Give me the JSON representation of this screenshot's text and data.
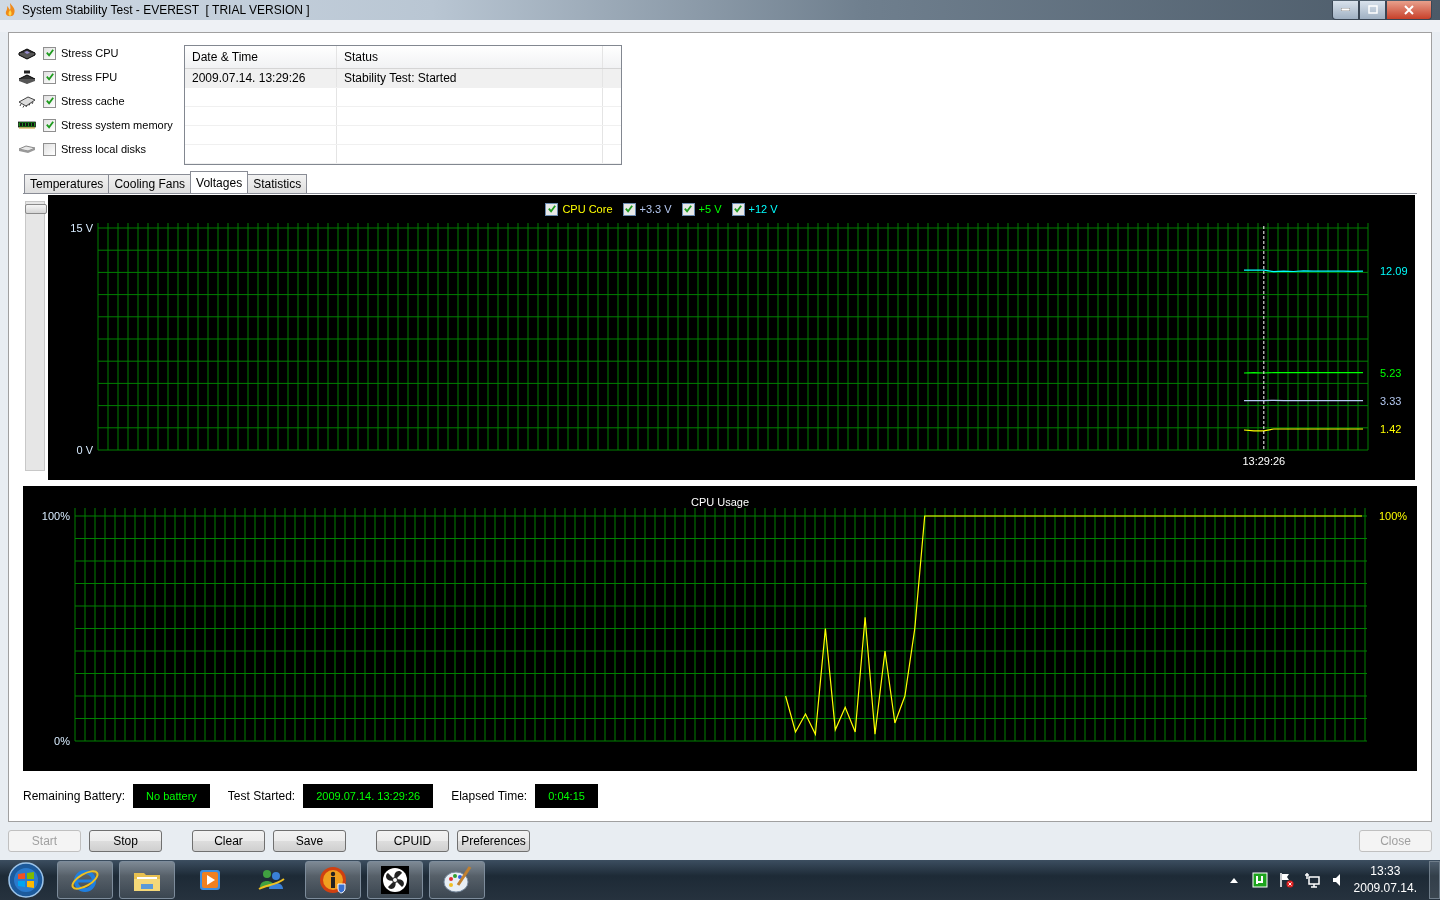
{
  "window": {
    "title": "System Stability Test - EVEREST  [ TRIAL VERSION ]"
  },
  "stress_options": [
    {
      "label": "Stress CPU",
      "checked": true,
      "kind": "cpu"
    },
    {
      "label": "Stress FPU",
      "checked": true,
      "kind": "fpu"
    },
    {
      "label": "Stress cache",
      "checked": true,
      "kind": "cache"
    },
    {
      "label": "Stress system memory",
      "checked": true,
      "kind": "memory"
    },
    {
      "label": "Stress local disks",
      "checked": false,
      "kind": "disk"
    }
  ],
  "log": {
    "columns": [
      "Date & Time",
      "Status"
    ],
    "rows": [
      [
        "2009.07.14. 13:29:26",
        "Stability Test: Started"
      ]
    ]
  },
  "tabs": [
    {
      "label": "Temperatures",
      "selected": false
    },
    {
      "label": "Cooling Fans",
      "selected": false
    },
    {
      "label": "Voltages",
      "selected": true
    },
    {
      "label": "Statistics",
      "selected": false
    }
  ],
  "voltage_chart": {
    "legend": [
      {
        "checked": true
      },
      {
        "checked": true
      },
      {
        "checked": true
      },
      {
        "checked": true
      }
    ],
    "chart_data": {
      "type": "line",
      "ylim": [
        0,
        15
      ],
      "yticks": [
        {
          "value": 0,
          "label": "0 V"
        },
        {
          "value": 15,
          "label": "15 V"
        }
      ],
      "categories": [
        null,
        null,
        null,
        null,
        null,
        null,
        null,
        null,
        null,
        null,
        null,
        null,
        null,
        null,
        null,
        null,
        null,
        null,
        null,
        null,
        null,
        null,
        null,
        null,
        null,
        null,
        null,
        null,
        null,
        null,
        null,
        null,
        null,
        null,
        null,
        null,
        null,
        null,
        null,
        null,
        null,
        null,
        null,
        null,
        null,
        null,
        null,
        null,
        null,
        null,
        null,
        null,
        null,
        null,
        null,
        null,
        null,
        null,
        null,
        null,
        null,
        null,
        null,
        null,
        null,
        null,
        null,
        null,
        null,
        null,
        null,
        null,
        null,
        null,
        null,
        null,
        null,
        null,
        null,
        null,
        null,
        null,
        null,
        null,
        null,
        null,
        null,
        null,
        null,
        null,
        null,
        null,
        null,
        null,
        null,
        null,
        null,
        null,
        null,
        null,
        null,
        null,
        null,
        null,
        null,
        null,
        null,
        null,
        null,
        null,
        null,
        null,
        null,
        null,
        null,
        null,
        null,
        "13:29:26",
        null,
        null,
        null,
        null,
        null,
        null,
        null,
        null,
        null,
        null
      ],
      "series": [
        {
          "name": "CPU Core",
          "color": "#ffff00",
          "values": [
            null,
            null,
            null,
            null,
            null,
            null,
            null,
            null,
            null,
            null,
            null,
            null,
            null,
            null,
            null,
            null,
            null,
            null,
            null,
            null,
            null,
            null,
            null,
            null,
            null,
            null,
            null,
            null,
            null,
            null,
            null,
            null,
            null,
            null,
            null,
            null,
            null,
            null,
            null,
            null,
            null,
            null,
            null,
            null,
            null,
            null,
            null,
            null,
            null,
            null,
            null,
            null,
            null,
            null,
            null,
            null,
            null,
            null,
            null,
            null,
            null,
            null,
            null,
            null,
            null,
            null,
            null,
            null,
            null,
            null,
            null,
            null,
            null,
            null,
            null,
            null,
            null,
            null,
            null,
            null,
            null,
            null,
            null,
            null,
            null,
            null,
            null,
            null,
            null,
            null,
            null,
            null,
            null,
            null,
            null,
            null,
            null,
            null,
            null,
            null,
            null,
            null,
            null,
            null,
            null,
            null,
            null,
            null,
            null,
            null,
            null,
            null,
            null,
            null,
            null,
            1.35,
            1.3,
            1.3,
            1.42,
            1.42,
            1.42,
            1.42,
            1.42,
            1.42,
            1.42,
            1.42,
            1.42,
            1.42
          ]
        },
        {
          "name": "+3.3 V",
          "color": "#b4c8f0",
          "values": [
            null,
            null,
            null,
            null,
            null,
            null,
            null,
            null,
            null,
            null,
            null,
            null,
            null,
            null,
            null,
            null,
            null,
            null,
            null,
            null,
            null,
            null,
            null,
            null,
            null,
            null,
            null,
            null,
            null,
            null,
            null,
            null,
            null,
            null,
            null,
            null,
            null,
            null,
            null,
            null,
            null,
            null,
            null,
            null,
            null,
            null,
            null,
            null,
            null,
            null,
            null,
            null,
            null,
            null,
            null,
            null,
            null,
            null,
            null,
            null,
            null,
            null,
            null,
            null,
            null,
            null,
            null,
            null,
            null,
            null,
            null,
            null,
            null,
            null,
            null,
            null,
            null,
            null,
            null,
            null,
            null,
            null,
            null,
            null,
            null,
            null,
            null,
            null,
            null,
            null,
            null,
            null,
            null,
            null,
            null,
            null,
            null,
            null,
            null,
            null,
            null,
            null,
            null,
            null,
            null,
            null,
            null,
            null,
            null,
            null,
            null,
            null,
            null,
            null,
            null,
            3.33,
            3.33,
            3.33,
            3.36,
            3.33,
            3.33,
            3.33,
            3.33,
            3.33,
            3.33,
            3.33,
            3.33,
            3.33
          ]
        },
        {
          "name": "+5 V",
          "color": "#00ff00",
          "values": [
            null,
            null,
            null,
            null,
            null,
            null,
            null,
            null,
            null,
            null,
            null,
            null,
            null,
            null,
            null,
            null,
            null,
            null,
            null,
            null,
            null,
            null,
            null,
            null,
            null,
            null,
            null,
            null,
            null,
            null,
            null,
            null,
            null,
            null,
            null,
            null,
            null,
            null,
            null,
            null,
            null,
            null,
            null,
            null,
            null,
            null,
            null,
            null,
            null,
            null,
            null,
            null,
            null,
            null,
            null,
            null,
            null,
            null,
            null,
            null,
            null,
            null,
            null,
            null,
            null,
            null,
            null,
            null,
            null,
            null,
            null,
            null,
            null,
            null,
            null,
            null,
            null,
            null,
            null,
            null,
            null,
            null,
            null,
            null,
            null,
            null,
            null,
            null,
            null,
            null,
            null,
            null,
            null,
            null,
            null,
            null,
            null,
            null,
            null,
            null,
            null,
            null,
            null,
            null,
            null,
            null,
            null,
            null,
            null,
            null,
            null,
            null,
            null,
            null,
            null,
            5.2,
            5.22,
            5.2,
            5.23,
            5.23,
            5.23,
            5.23,
            5.23,
            5.23,
            5.23,
            5.23,
            5.23,
            5.23
          ]
        },
        {
          "name": "+12 V",
          "color": "#00ffff",
          "values": [
            null,
            null,
            null,
            null,
            null,
            null,
            null,
            null,
            null,
            null,
            null,
            null,
            null,
            null,
            null,
            null,
            null,
            null,
            null,
            null,
            null,
            null,
            null,
            null,
            null,
            null,
            null,
            null,
            null,
            null,
            null,
            null,
            null,
            null,
            null,
            null,
            null,
            null,
            null,
            null,
            null,
            null,
            null,
            null,
            null,
            null,
            null,
            null,
            null,
            null,
            null,
            null,
            null,
            null,
            null,
            null,
            null,
            null,
            null,
            null,
            null,
            null,
            null,
            null,
            null,
            null,
            null,
            null,
            null,
            null,
            null,
            null,
            null,
            null,
            null,
            null,
            null,
            null,
            null,
            null,
            null,
            null,
            null,
            null,
            null,
            null,
            null,
            null,
            null,
            null,
            null,
            null,
            null,
            null,
            null,
            null,
            null,
            null,
            null,
            null,
            null,
            null,
            null,
            null,
            null,
            null,
            null,
            null,
            null,
            null,
            null,
            null,
            null,
            null,
            null,
            12.15,
            12.15,
            12.15,
            12.05,
            12.08,
            12.06,
            12.1,
            12.09,
            12.09,
            12.09,
            12.09,
            12.07,
            12.09
          ]
        }
      ],
      "annotations": [
        "1.42",
        "3.33",
        "5.23",
        "12.09"
      ]
    }
  },
  "cpu_chart": {
    "chart_data": {
      "type": "line",
      "title": "CPU Usage",
      "ylim": [
        0,
        100
      ],
      "yticks": [
        {
          "value": 0,
          "label": "0%"
        },
        {
          "value": 100,
          "label": "100%"
        }
      ],
      "categories": [
        null,
        null,
        null,
        null,
        null,
        null,
        null,
        null,
        null,
        null,
        null,
        null,
        null,
        null,
        null,
        null,
        null,
        null,
        null,
        null,
        null,
        null,
        null,
        null,
        null,
        null,
        null,
        null,
        null,
        null,
        null,
        null,
        null,
        null,
        null,
        null,
        null,
        null,
        null,
        null,
        null,
        null,
        null,
        null,
        null,
        null,
        null,
        null,
        null,
        null,
        null,
        null,
        null,
        null,
        null,
        null,
        null,
        null,
        null,
        null,
        null,
        null,
        null,
        null,
        null,
        null,
        null,
        null,
        null,
        null,
        null,
        null,
        null,
        null,
        null,
        null,
        null,
        null,
        null,
        null,
        null,
        null,
        null,
        null,
        null,
        null,
        null,
        null,
        null,
        null,
        null,
        null,
        null,
        null,
        null,
        null,
        null,
        null,
        null,
        null,
        null,
        null,
        null,
        null,
        null,
        null,
        null,
        null,
        null,
        null,
        null,
        null,
        null,
        null,
        null,
        null,
        null,
        null,
        null,
        null,
        null,
        null,
        null,
        null,
        null,
        null,
        null,
        null,
        null,
        null
      ],
      "series": [
        {
          "color": "#ffff00",
          "values": [
            null,
            null,
            null,
            null,
            null,
            null,
            null,
            null,
            null,
            null,
            null,
            null,
            null,
            null,
            null,
            null,
            null,
            null,
            null,
            null,
            null,
            null,
            null,
            null,
            null,
            null,
            null,
            null,
            null,
            null,
            null,
            null,
            null,
            null,
            null,
            null,
            null,
            null,
            null,
            null,
            null,
            null,
            null,
            null,
            null,
            null,
            null,
            null,
            null,
            null,
            null,
            null,
            null,
            null,
            null,
            null,
            null,
            null,
            null,
            null,
            null,
            null,
            null,
            null,
            null,
            null,
            null,
            null,
            null,
            null,
            null,
            20,
            4,
            12,
            3,
            50,
            5,
            15,
            4,
            55,
            3,
            40,
            8,
            20,
            50,
            100,
            100,
            100,
            100,
            100,
            100,
            100,
            100,
            100,
            100,
            100,
            100,
            100,
            100,
            100,
            100,
            100,
            100,
            100,
            100,
            100,
            100,
            100,
            100,
            100,
            100,
            100,
            100,
            100,
            100,
            100,
            100,
            100,
            100,
            100,
            100,
            100,
            100,
            100,
            100,
            100,
            100,
            100,
            100,
            100
          ]
        }
      ],
      "annotations": [
        "100%"
      ]
    }
  },
  "info": [
    {
      "label": "Remaining Battery:",
      "value": "No battery"
    },
    {
      "label": "Test Started:",
      "value": "2009.07.14. 13:29:26"
    },
    {
      "label": "Elapsed Time:",
      "value": "0:04:15"
    }
  ],
  "button_groups": [
    [
      {
        "label": "Start",
        "disabled": true
      },
      {
        "label": "Stop",
        "disabled": false
      }
    ],
    [
      {
        "label": "Clear",
        "disabled": false
      },
      {
        "label": "Save",
        "disabled": false
      }
    ],
    [
      {
        "label": "CPUID",
        "disabled": false
      },
      {
        "label": "Preferences",
        "disabled": false
      }
    ]
  ],
  "close_button": {
    "label": "Close",
    "disabled": true
  },
  "taskbar": {
    "apps": [
      {
        "kind": "browser",
        "running": true
      },
      {
        "kind": "folder",
        "running": true
      },
      {
        "kind": "media",
        "running": false
      },
      {
        "kind": "messenger",
        "running": false
      },
      {
        "kind": "info",
        "running": true
      },
      {
        "kind": "fan",
        "running": true
      },
      {
        "kind": "paint",
        "running": true
      }
    ],
    "clock": {
      "time": "13:33",
      "date": "2009.07.14."
    }
  }
}
